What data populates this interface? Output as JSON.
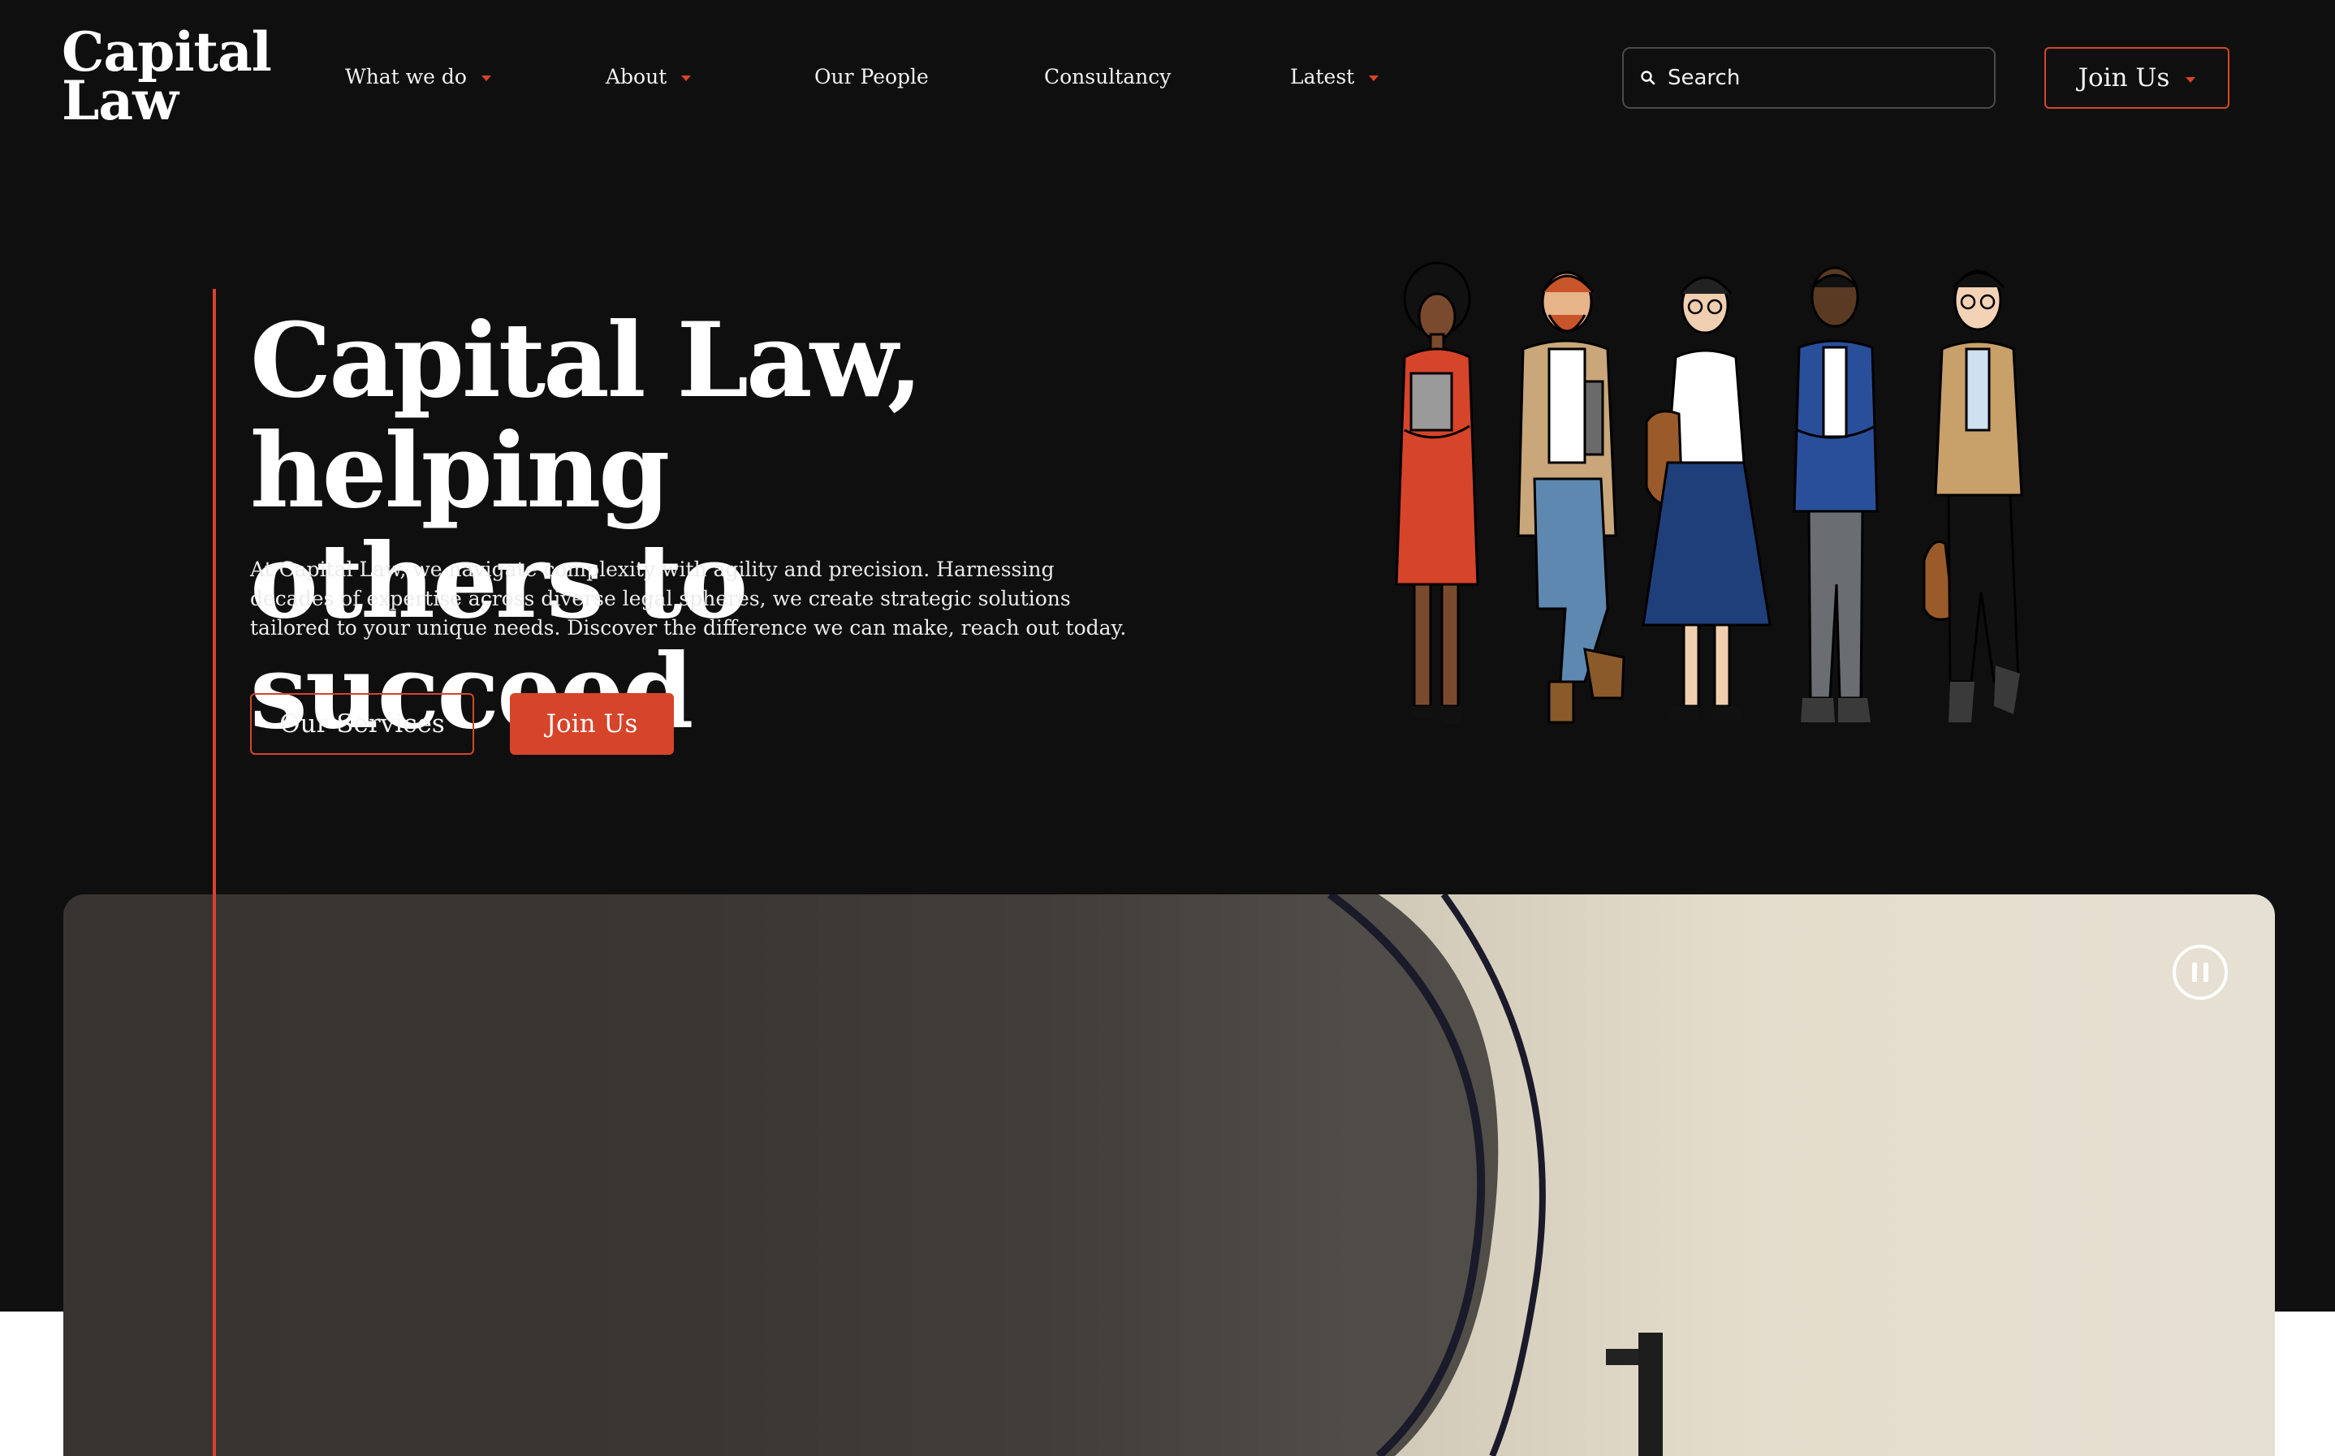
{
  "header": {
    "logo_line1": "Capital",
    "logo_line2": "Law",
    "nav": [
      {
        "label": "What we do",
        "has_dropdown": true
      },
      {
        "label": "About",
        "has_dropdown": true
      },
      {
        "label": "Our People",
        "has_dropdown": false
      },
      {
        "label": "Consultancy",
        "has_dropdown": false
      },
      {
        "label": "Latest",
        "has_dropdown": true
      }
    ],
    "search_placeholder": "Search",
    "join_label": "Join Us"
  },
  "hero": {
    "title_line1": "Capital Law, helping",
    "title_line2": "others to succeed",
    "description": "At Capital Law, we navigate complexity with agility and precision. Harnessing decades of expertise across diverse legal spheres, we create strategic solutions tailored to your unique needs. Discover the difference we can make, reach out today.",
    "primary_button": "Our Services",
    "secondary_button": "Join Us"
  },
  "icons": {
    "search": "search-icon",
    "caret": "chevron-down-icon",
    "pause": "pause-icon"
  },
  "colors": {
    "background": "#0f0f10",
    "accent": "#d6442a",
    "text": "#ffffff"
  }
}
